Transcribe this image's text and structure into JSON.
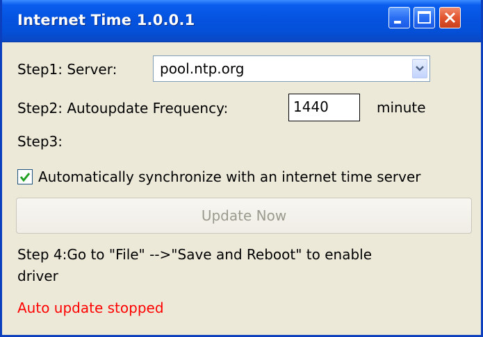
{
  "window": {
    "title": "Internet Time 1.0.0.1"
  },
  "titlebar_buttons": {
    "minimize_icon": "minimize-icon",
    "maximize_icon": "maximize-icon",
    "close_icon": "close-icon"
  },
  "step1": {
    "label": "Step1: Server:",
    "server_value": "pool.ntp.org"
  },
  "step2": {
    "label": "Step2: Autoupdate Frequency:",
    "frequency_value": "1440",
    "unit": "minute"
  },
  "step3": {
    "label": "Step3:",
    "auto_sync_label": "Automatically synchronize with an internet time server",
    "auto_sync_checked": true
  },
  "update_button": {
    "label": "Update Now",
    "enabled": false
  },
  "step4": {
    "line1": "Step 4:Go to \"File\" -->\"Save and Reboot\" to enable",
    "line2": "driver"
  },
  "status": {
    "text": "Auto update stopped",
    "color": "#ff0000"
  },
  "colors": {
    "titlebar": "#0553e0",
    "window_bg": "#ece9d8",
    "checkmark": "#21a121"
  }
}
